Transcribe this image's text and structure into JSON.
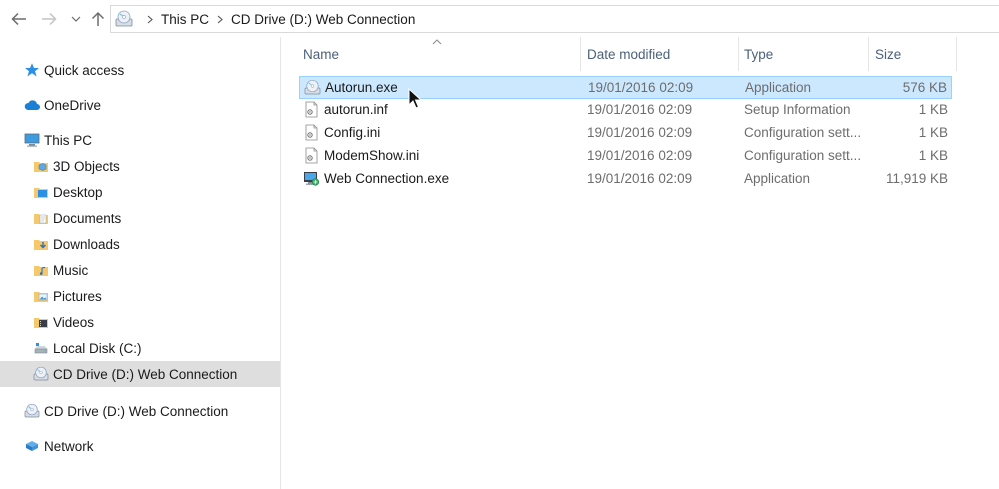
{
  "address_bar": {
    "crumbs": [
      "This PC",
      "CD Drive (D:) Web Connection"
    ]
  },
  "nav_pane": {
    "quick_access": "Quick access",
    "onedrive": "OneDrive",
    "this_pc": "This PC",
    "children": [
      {
        "label": "3D Objects",
        "icon": "3d-objects-folder-icon"
      },
      {
        "label": "Desktop",
        "icon": "desktop-folder-icon"
      },
      {
        "label": "Documents",
        "icon": "documents-folder-icon"
      },
      {
        "label": "Downloads",
        "icon": "downloads-folder-icon"
      },
      {
        "label": "Music",
        "icon": "music-folder-icon"
      },
      {
        "label": "Pictures",
        "icon": "pictures-folder-icon"
      },
      {
        "label": "Videos",
        "icon": "videos-folder-icon"
      },
      {
        "label": "Local Disk (C:)",
        "icon": "hard-drive-icon"
      },
      {
        "label": "CD Drive (D:) Web Connection",
        "icon": "cd-drive-icon",
        "selected": true
      }
    ],
    "cd_drive": "CD Drive (D:) Web Connection",
    "network": "Network"
  },
  "file_list": {
    "columns": {
      "name": "Name",
      "date": "Date modified",
      "type": "Type",
      "size": "Size"
    },
    "sort_column": "Name",
    "rows": [
      {
        "name": "Autorun.exe",
        "date": "19/01/2016 02:09",
        "type": "Application",
        "size": "576 KB",
        "icon": "autorun-exe-icon",
        "selected": true
      },
      {
        "name": "autorun.inf",
        "date": "19/01/2016 02:09",
        "type": "Setup Information",
        "size": "1 KB",
        "icon": "inf-file-icon"
      },
      {
        "name": "Config.ini",
        "date": "19/01/2016 02:09",
        "type": "Configuration sett...",
        "size": "1 KB",
        "icon": "ini-file-icon"
      },
      {
        "name": "ModemShow.ini",
        "date": "19/01/2016 02:09",
        "type": "Configuration sett...",
        "size": "1 KB",
        "icon": "ini-file-icon"
      },
      {
        "name": "Web Connection.exe",
        "date": "19/01/2016 02:09",
        "type": "Application",
        "size": "11,919 KB",
        "icon": "web-connection-exe-icon"
      }
    ]
  },
  "colors": {
    "selection_fill": "#cce8ff",
    "selection_border": "#99d1ff",
    "nav_selected": "#dedede",
    "header_text": "#4c607a",
    "secondary_text": "#6d6d6d"
  }
}
